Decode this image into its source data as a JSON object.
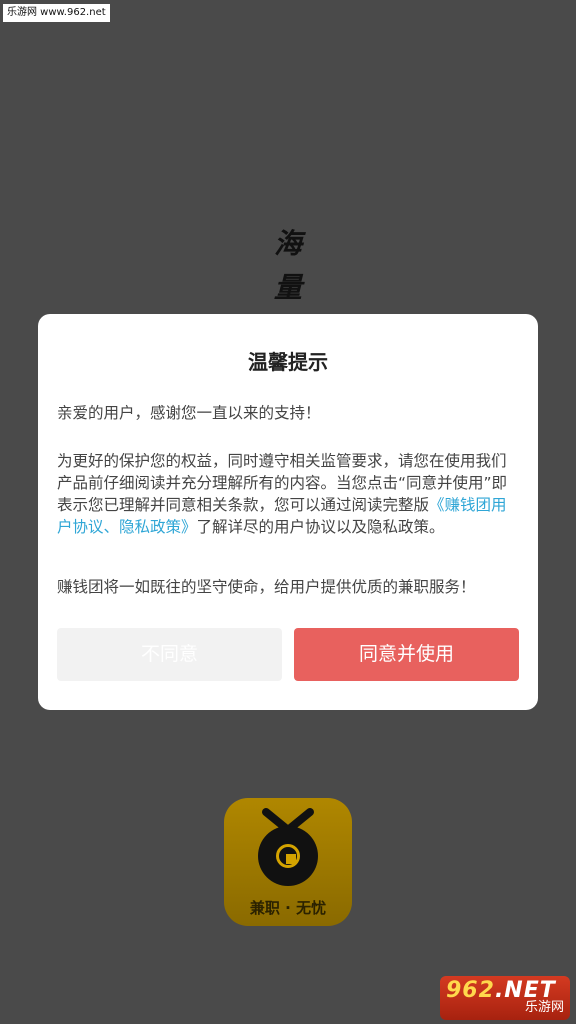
{
  "watermark_top": "乐游网 www.962.net",
  "splash": {
    "char1": "海",
    "char2": "量"
  },
  "dialog": {
    "title": "温馨提示",
    "greeting": "亲爱的用户，感谢您一直以来的支持！",
    "body_before_link": "为更好的保护您的权益，同时遵守相关监管要求，请您在使用我们产品前仔细阅读并充分理解所有的内容。当您点击“同意并使用”即表示您已理解并同意相关条款，您可以通过阅读完整版",
    "link_text": "《赚钱团用户协议、隐私政策》",
    "body_after_link": "了解详尽的用户协议以及隐私政策。",
    "commitment": "赚钱团将一如既往的坚守使命，给用户提供优质的兼职服务！",
    "disagree_label": "不同意",
    "agree_label": "同意并使用"
  },
  "app_logo": {
    "tagline": "兼职 · 无忧"
  },
  "watermark_bottom": {
    "num": "962",
    "net": ".NET",
    "sub": "乐游网"
  },
  "colors": {
    "overlay_bg": "#4a4a4a",
    "agree_button": "#e8615e",
    "disagree_button": "#f2f2f2",
    "link": "#2fa6d6"
  },
  "icons": [
    "coin-icon"
  ]
}
